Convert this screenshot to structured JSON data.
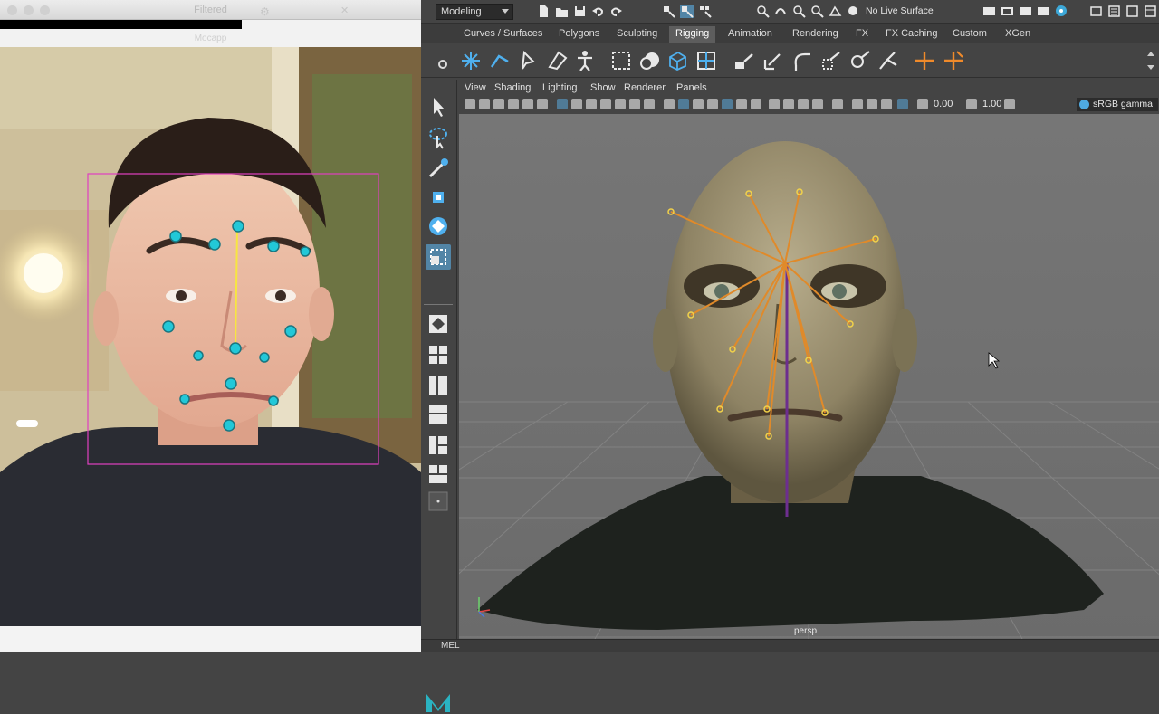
{
  "webcam": {
    "title": "Filtered",
    "subtitle": "Mocapp"
  },
  "maya": {
    "menu_set": "Modeling",
    "live_surface": "No Live Surface",
    "shelf_tabs": [
      "Curves / Surfaces",
      "Polygons",
      "Sculpting",
      "Rigging",
      "Animation",
      "Rendering",
      "FX",
      "FX Caching",
      "Custom",
      "XGen"
    ],
    "active_shelf_tab": "Rigging",
    "panel_menu": [
      "View",
      "Shading",
      "Lighting",
      "Show",
      "Renderer",
      "Panels"
    ],
    "exposure": "0.00",
    "gamma": "1.00",
    "color_space": "sRGB gamma",
    "camera": "persp",
    "command_line_label": "MEL",
    "colors": {
      "tracker_box": "#e040c0",
      "tracker_points": "#22c8d8",
      "rig_lines": "#e08a2a",
      "active_tab": "#5d5d5d",
      "active_tool": "#5285a6"
    }
  }
}
